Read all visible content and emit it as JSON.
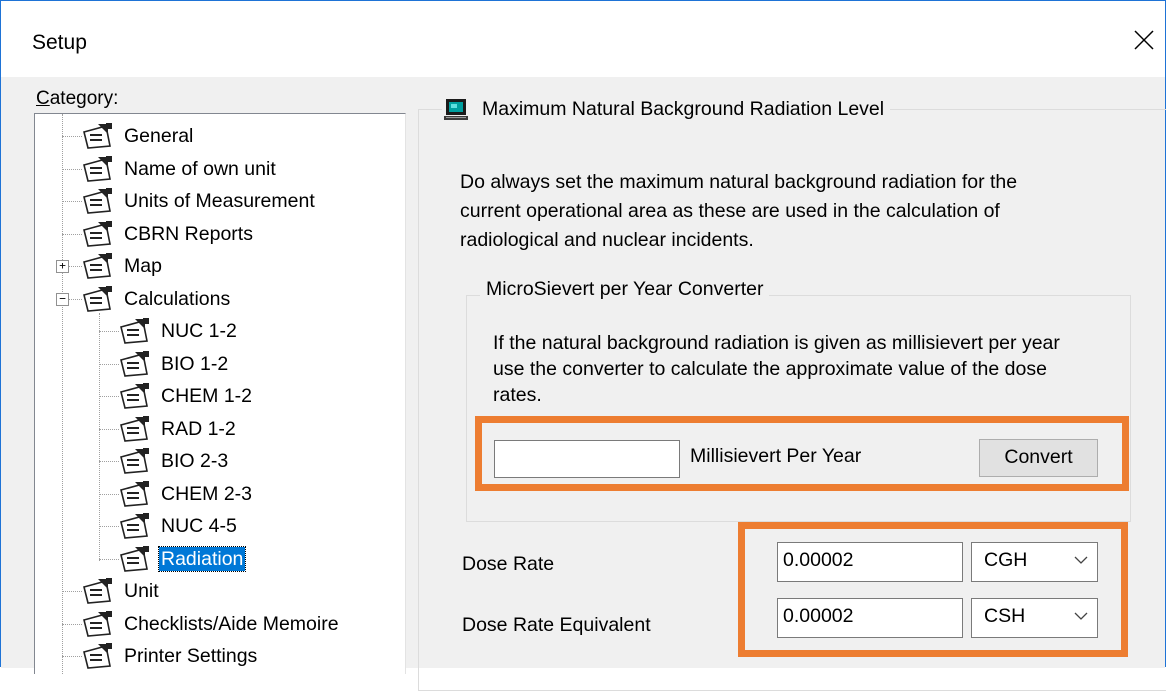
{
  "window": {
    "title": "Setup"
  },
  "category_label": "Category:",
  "tree": {
    "items": [
      {
        "label": "General",
        "level": 0
      },
      {
        "label": "Name of own unit",
        "level": 0
      },
      {
        "label": "Units of Measurement",
        "level": 0
      },
      {
        "label": "CBRN Reports",
        "level": 0
      },
      {
        "label": "Map",
        "level": 0,
        "expander": "+"
      },
      {
        "label": "Calculations",
        "level": 0,
        "expander": "-"
      },
      {
        "label": "NUC 1-2",
        "level": 1
      },
      {
        "label": "BIO 1-2",
        "level": 1
      },
      {
        "label": "CHEM 1-2",
        "level": 1
      },
      {
        "label": "RAD 1-2",
        "level": 1
      },
      {
        "label": "BIO 2-3",
        "level": 1
      },
      {
        "label": "CHEM 2-3",
        "level": 1
      },
      {
        "label": "NUC 4-5",
        "level": 1
      },
      {
        "label": "Radiation",
        "level": 1,
        "selected": true
      },
      {
        "label": "Unit",
        "level": 0
      },
      {
        "label": "Checklists/Aide Memoire",
        "level": 0
      },
      {
        "label": "Printer Settings",
        "level": 0
      }
    ]
  },
  "main_group": {
    "title": "Maximum Natural Background Radiation Level",
    "description": "Do always set the maximum natural background radiation for the current operational area as these are used in the calculation of radiological and nuclear incidents."
  },
  "converter": {
    "title": "MicroSievert per Year Converter",
    "description": "If the natural background radiation is given as millisievert per year use the converter to calculate the approximate value of the dose rates.",
    "input_value": "",
    "unit_label": "Millisievert Per Year",
    "button_label": "Convert"
  },
  "dose_rate": {
    "label": "Dose Rate",
    "value": "0.00002",
    "unit": "CGH"
  },
  "dose_rate_equivalent": {
    "label": "Dose Rate Equivalent",
    "value": "0.00002",
    "unit": "CSH"
  },
  "colors": {
    "highlight": "#ed7d31",
    "selection": "#0078d7",
    "window_border": "#1e73d6"
  },
  "icons": {
    "close": "close-icon",
    "tree_item": "settings-page-icon",
    "group": "monitor-icon",
    "dropdown": "chevron-down-icon"
  }
}
